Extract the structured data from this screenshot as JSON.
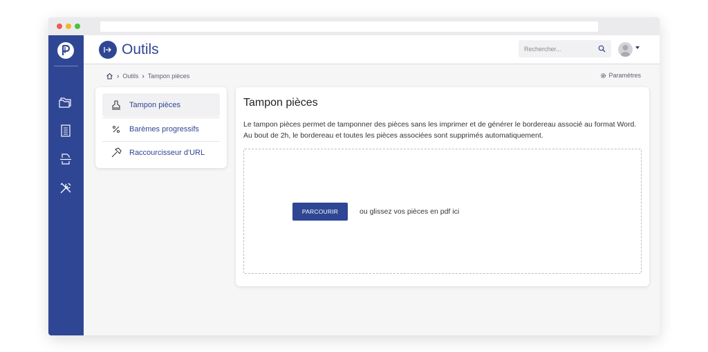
{
  "colors": {
    "brand": "#2f4694",
    "sidebar": "#2f4694",
    "page_bg": "#f6f6f7"
  },
  "sidebar": {
    "logo_icon": "p-logo-icon",
    "items": [
      {
        "icon": "folders-icon"
      },
      {
        "icon": "document-list-icon"
      },
      {
        "icon": "document-scan-icon"
      },
      {
        "icon": "tools-icon"
      }
    ]
  },
  "header": {
    "title_icon": "tools-arrow-icon",
    "title": "Outils",
    "search_placeholder": "Rechercher...",
    "search_icon": "search-icon",
    "avatar_icon": "user-avatar-icon"
  },
  "breadcrumb": {
    "home_icon": "home-icon",
    "items": [
      "Outils",
      "Tampon pièces"
    ]
  },
  "settings_link": "Paramètres",
  "menu": {
    "items": [
      {
        "label": "Tampon pièces",
        "icon": "stamp-icon",
        "active": true
      },
      {
        "label": "Barèmes progressifs",
        "icon": "percent-icon",
        "active": false
      },
      {
        "label": "Raccourcisseur d'URL",
        "icon": "hammer-icon",
        "active": false
      }
    ]
  },
  "main": {
    "title": "Tampon pièces",
    "description": "Le tampon pièces permet de tamponner des pièces sans les imprimer et de générer le bordereau associé au format Word. Au bout de 2h, le bordereau et toutes les pièces associées sont supprimés automatiquement.",
    "browse_label": "PARCOURIR",
    "drop_text": "ou glissez vos pièces en pdf ici"
  }
}
